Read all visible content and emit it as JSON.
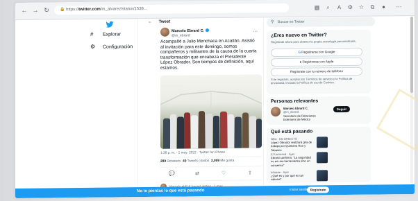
{
  "browser": {
    "url_host": "twitter.com",
    "url_prefix": "https://",
    "url_rest": "/m_alvarez/status/1539..."
  },
  "nav": {
    "explore_label": "Explorar",
    "settings_label": "Configuración"
  },
  "tweet": {
    "header_title": "Tweet",
    "author_name": "Marcelo Ebrard C.",
    "author_handle": "@m_ebrard",
    "text": "Acompañé a Julio Menchaca en Acatlán. Asistió al invitación para este domingo, somos compañeros y militantes de la causa de la cuarta transformación que encabeza el Presidente López Obrador. Son tiempos de definición, aquí estamos.",
    "meta": "1:38 p. m. · 1 may. 2022 · Twitter for iPhone",
    "retweets_count": "289",
    "retweets_label": "Retweets",
    "quotes_count": "40",
    "quotes_label": "Tweets citados",
    "likes_count": "2,009",
    "likes_label": "Me gusta",
    "reply_preview": "Marcelo ebR & (more) replies · 1 may"
  },
  "sidebar": {
    "search_placeholder": "Buscar en Twitter",
    "signup_title": "¿Eres nuevo en Twitter?",
    "signup_sub": "Regístrate ahora para obtener tu propia cronología personalizada.",
    "google_btn": "Registrarse con Google",
    "apple_btn": "Registrarse con Apple",
    "phone_btn": "Regístrate con tu número de teléfono",
    "terms": "Si te registras, aceptas los Términos de servicio y la Política de privacidad, incluida la Política de uso de Cookies.",
    "relevant_title": "Personas relevantes",
    "relevant_name": "Marcelo Ebrard C.",
    "relevant_handle": "@m_ebrard",
    "relevant_bio": "Secretario de Relaciones Exteriores de México",
    "follow_btn": "Seguir",
    "trending_title": "Qué está pasando",
    "trends": [
      {
        "cat": "NBA · EN DIRECTO",
        "text": "López Obrador realizará gira de trabajo por Quintana Roo y Tabasco"
      },
      {
        "cat": "El Universal · Ayer",
        "text": "Ebrard confirma: \"La seguridad no es una herramienta sino un consenso\""
      },
      {
        "cat": "Infobae · Ayer",
        "text": "¿Qué es y por qué es tan valioso?"
      }
    ]
  },
  "bottom_bar": {
    "message": "No te pierdas lo que está pasando",
    "login": "Iniciar sesión",
    "signup": "Regístrate"
  },
  "colors": {
    "accent": "#1d9bf0",
    "text": "#0f1419",
    "muted": "#536471"
  }
}
